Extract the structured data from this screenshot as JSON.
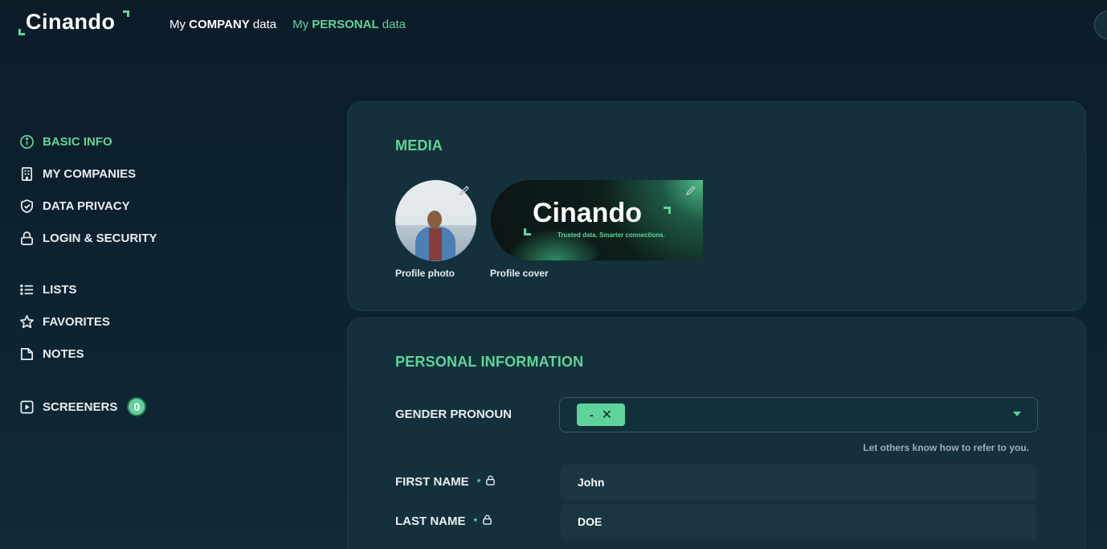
{
  "brand": {
    "logo_text": "Cinando"
  },
  "topnav": {
    "company": {
      "prefix": "My",
      "strong": "COMPANY",
      "suffix": "data"
    },
    "personal": {
      "prefix": "My",
      "strong": "PERSONAL",
      "suffix": "data"
    }
  },
  "sidebar": {
    "items": [
      {
        "label": "BASIC INFO",
        "icon": "info-circle-icon",
        "active": true
      },
      {
        "label": "MY COMPANIES",
        "icon": "building-icon"
      },
      {
        "label": "DATA PRIVACY",
        "icon": "shield-check-icon"
      },
      {
        "label": "LOGIN & SECURITY",
        "icon": "lock-icon"
      },
      {
        "label": "LISTS",
        "icon": "list-icon"
      },
      {
        "label": "FAVORITES",
        "icon": "star-icon"
      },
      {
        "label": "NOTES",
        "icon": "note-icon"
      },
      {
        "label": "SCREENERS",
        "icon": "play-square-icon",
        "badge": "0"
      }
    ]
  },
  "media": {
    "title": "MEDIA",
    "photo_label": "Profile photo",
    "cover_label": "Profile cover",
    "cover_word": "Cinando",
    "cover_tagline": "Trusted data. Smarter connections."
  },
  "personal": {
    "title": "PERSONAL INFORMATION",
    "gender": {
      "label": "GENDER PRONOUN",
      "chip": "-",
      "chip_remove": "✕",
      "hint": "Let others know how to refer to you."
    },
    "first_name": {
      "label": "FIRST NAME",
      "required": "*",
      "value": "John"
    },
    "last_name": {
      "label": "LAST NAME",
      "required": "*",
      "value": "DOE"
    }
  },
  "colors": {
    "accent": "#5fd49a",
    "background": "#0c1f2a",
    "card": "#14303b"
  }
}
